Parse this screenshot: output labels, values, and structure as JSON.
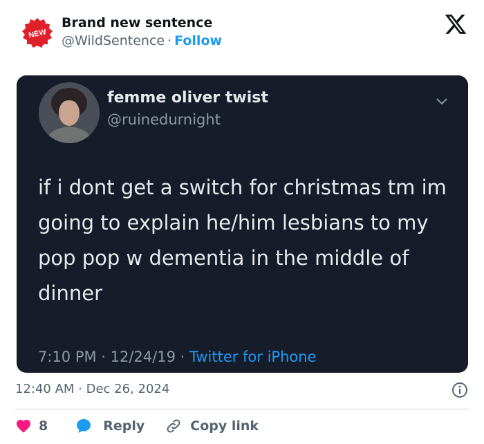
{
  "author": {
    "name": "Brand new sentence",
    "handle": "@WildSentence",
    "separator": "·",
    "follow_label": "Follow",
    "badge_text": "NEW"
  },
  "brand_icon": "x-logo-icon",
  "embedded_tweet": {
    "name": "femme oliver twist",
    "handle": "@ruinedurnight",
    "text": "if i dont get a switch for christmas tm im going to explain he/him lesbians to my pop pop w dementia in the middle of dinner",
    "meta_time": "7:10 PM · 12/24/19 · ",
    "meta_source": "Twitter for iPhone",
    "background_color": "#171c2b"
  },
  "timestamp": "12:40 AM · Dec 26, 2024",
  "actions": {
    "like_count": "8",
    "reply_label": "Reply",
    "copy_label": "Copy link"
  },
  "colors": {
    "accent": "#1d9bf0",
    "like": "#f91880",
    "badge_red": "#e0202a"
  }
}
